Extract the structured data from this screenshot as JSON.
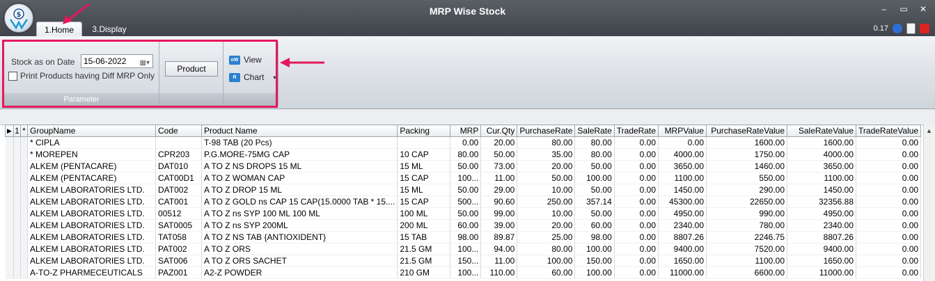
{
  "window": {
    "title": "MRP Wise Stock",
    "version": "0.17",
    "minimize": "–",
    "maximize": "▭",
    "close": "✕"
  },
  "tabs": [
    {
      "label": "1.Home"
    },
    {
      "label": "3.Display"
    }
  ],
  "parameter": {
    "stock_label": "Stock as on Date",
    "date_value": "15-06-2022",
    "diff_mrp_label": "Print Products having Diff MRP Only",
    "group_label": "Parameter"
  },
  "product_button": "Product",
  "view": {
    "view_label": "View",
    "chart_label": "Chart",
    "view_icon": "oW",
    "chart_icon": "R"
  },
  "colors": {
    "highlight": "#e5185b",
    "accent": "#2a7fd0"
  },
  "grid": {
    "columns": [
      "GroupName",
      "Code",
      "Product Name",
      "Packing",
      "MRP",
      "Cur.Qty",
      "PurchaseRate",
      "SaleRate",
      "TradeRate",
      "MRPValue",
      "PurchaseRateValue",
      "SaleRateValue",
      "TradeRateValue"
    ],
    "row_header_marker": "▶",
    "row_header_index": "1",
    "row_header_star": "*",
    "rows": [
      [
        "* CIPLA",
        "",
        "T-98 TAB (20 Pcs)",
        "",
        "0.00",
        "20.00",
        "80.00",
        "80.00",
        "0.00",
        "0.00",
        "1600.00",
        "1600.00",
        "0.00"
      ],
      [
        "* MOREPEN",
        "CPR203",
        "P.G.MORE-75MG CAP",
        "10 CAP",
        "80.00",
        "50.00",
        "35.00",
        "80.00",
        "0.00",
        "4000.00",
        "1750.00",
        "4000.00",
        "0.00"
      ],
      [
        "ALKEM (PENTACARE)",
        "DAT010",
        "A TO Z NS DROPS 15 ML",
        "15 ML",
        "50.00",
        "73.00",
        "20.00",
        "50.00",
        "0.00",
        "3650.00",
        "1460.00",
        "3650.00",
        "0.00"
      ],
      [
        "ALKEM (PENTACARE)",
        "CAT00D1",
        "A TO Z WOMAN CAP",
        "15 CAP",
        "100...",
        "11.00",
        "50.00",
        "100.00",
        "0.00",
        "1100.00",
        "550.00",
        "1100.00",
        "0.00"
      ],
      [
        "ALKEM LABORATORIES LTD.",
        "DAT002",
        "A TO Z DROP 15 ML",
        "15 ML",
        "50.00",
        "29.00",
        "10.00",
        "50.00",
        "0.00",
        "1450.00",
        "290.00",
        "1450.00",
        "0.00"
      ],
      [
        "ALKEM LABORATORIES LTD.",
        "CAT001",
        "A TO Z GOLD ns CAP 15 CAP(15.0000 TAB * 15....",
        "15 CAP",
        "500...",
        "90.60",
        "250.00",
        "357.14",
        "0.00",
        "45300.00",
        "22650.00",
        "32356.88",
        "0.00"
      ],
      [
        "ALKEM LABORATORIES LTD.",
        "00512",
        "A TO Z ns SYP 100 ML 100 ML",
        "100 ML",
        "50.00",
        "99.00",
        "10.00",
        "50.00",
        "0.00",
        "4950.00",
        "990.00",
        "4950.00",
        "0.00"
      ],
      [
        "ALKEM LABORATORIES LTD.",
        "SAT0005",
        "A TO Z ns SYP 200ML",
        "200 ML",
        "60.00",
        "39.00",
        "20.00",
        "60.00",
        "0.00",
        "2340.00",
        "780.00",
        "2340.00",
        "0.00"
      ],
      [
        "ALKEM LABORATORIES LTD.",
        "TAT058",
        "A TO Z NS TAB {ANTIOXIDENT}",
        "15 TAB",
        "98.00",
        "89.87",
        "25.00",
        "98.00",
        "0.00",
        "8807.26",
        "2246.75",
        "8807.26",
        "0.00"
      ],
      [
        "ALKEM LABORATORIES LTD.",
        "PAT002",
        "A TO Z ORS",
        "21.5 GM",
        "100...",
        "94.00",
        "80.00",
        "100.00",
        "0.00",
        "9400.00",
        "7520.00",
        "9400.00",
        "0.00"
      ],
      [
        "ALKEM LABORATORIES LTD.",
        "SAT006",
        "A TO Z ORS SACHET",
        "21.5 GM",
        "150...",
        "11.00",
        "100.00",
        "150.00",
        "0.00",
        "1650.00",
        "1100.00",
        "1650.00",
        "0.00"
      ],
      [
        "A-TO-Z PHARMECEUTICALS",
        "PAZ001",
        "A2-Z POWDER",
        "210 GM",
        "100...",
        "110.00",
        "60.00",
        "100.00",
        "0.00",
        "11000.00",
        "6600.00",
        "11000.00",
        "0.00"
      ]
    ]
  }
}
